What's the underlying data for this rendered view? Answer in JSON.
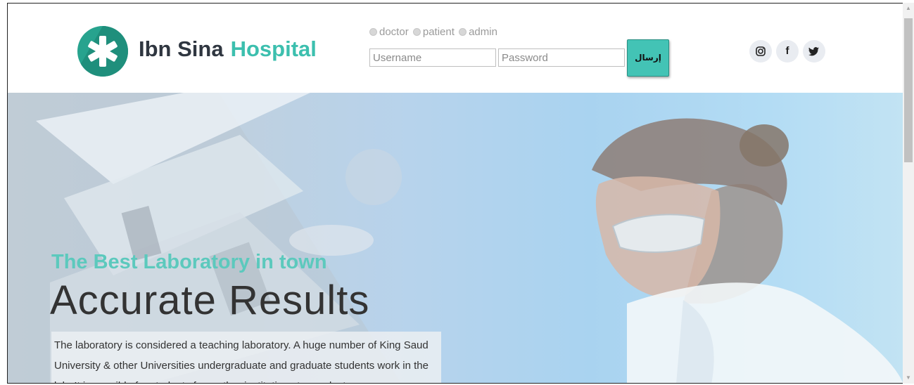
{
  "brand": {
    "name": "Ibn Sina",
    "accent": "Hospital",
    "accent_color": "#3cbfae",
    "logo_icon": "medical-star-icon"
  },
  "login": {
    "roles": [
      "doctor",
      "patient",
      "admin"
    ],
    "username_placeholder": "Username",
    "password_placeholder": "Password",
    "submit_label": "إرسال"
  },
  "social": [
    {
      "name": "instagram-icon",
      "glyph": "◎"
    },
    {
      "name": "facebook-icon",
      "glyph": "f"
    },
    {
      "name": "twitter-icon",
      "glyph": "🐦"
    }
  ],
  "hero": {
    "tagline": "The Best Laboratory in town",
    "headline": "Accurate Results",
    "description": "The laboratory is considered a teaching laboratory. A huge number of King Saud University & other Universities undergraduate and graduate students work in the lab. It is possible for students from other institutions to conduct"
  },
  "colors": {
    "teal": "#43c3b5",
    "dark_text": "#2f3640"
  }
}
